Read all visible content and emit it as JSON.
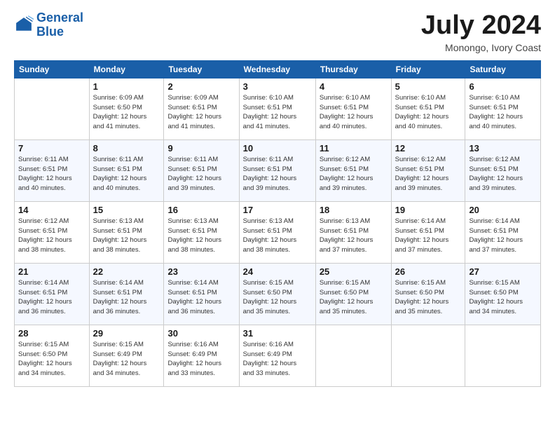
{
  "header": {
    "logo_line1": "General",
    "logo_line2": "Blue",
    "month_title": "July 2024",
    "location": "Monongo, Ivory Coast"
  },
  "days_of_week": [
    "Sunday",
    "Monday",
    "Tuesday",
    "Wednesday",
    "Thursday",
    "Friday",
    "Saturday"
  ],
  "weeks": [
    [
      {
        "day": "",
        "info": ""
      },
      {
        "day": "1",
        "info": "Sunrise: 6:09 AM\nSunset: 6:50 PM\nDaylight: 12 hours\nand 41 minutes."
      },
      {
        "day": "2",
        "info": "Sunrise: 6:09 AM\nSunset: 6:51 PM\nDaylight: 12 hours\nand 41 minutes."
      },
      {
        "day": "3",
        "info": "Sunrise: 6:10 AM\nSunset: 6:51 PM\nDaylight: 12 hours\nand 41 minutes."
      },
      {
        "day": "4",
        "info": "Sunrise: 6:10 AM\nSunset: 6:51 PM\nDaylight: 12 hours\nand 40 minutes."
      },
      {
        "day": "5",
        "info": "Sunrise: 6:10 AM\nSunset: 6:51 PM\nDaylight: 12 hours\nand 40 minutes."
      },
      {
        "day": "6",
        "info": "Sunrise: 6:10 AM\nSunset: 6:51 PM\nDaylight: 12 hours\nand 40 minutes."
      }
    ],
    [
      {
        "day": "7",
        "info": "Sunrise: 6:11 AM\nSunset: 6:51 PM\nDaylight: 12 hours\nand 40 minutes."
      },
      {
        "day": "8",
        "info": "Sunrise: 6:11 AM\nSunset: 6:51 PM\nDaylight: 12 hours\nand 40 minutes."
      },
      {
        "day": "9",
        "info": "Sunrise: 6:11 AM\nSunset: 6:51 PM\nDaylight: 12 hours\nand 39 minutes."
      },
      {
        "day": "10",
        "info": "Sunrise: 6:11 AM\nSunset: 6:51 PM\nDaylight: 12 hours\nand 39 minutes."
      },
      {
        "day": "11",
        "info": "Sunrise: 6:12 AM\nSunset: 6:51 PM\nDaylight: 12 hours\nand 39 minutes."
      },
      {
        "day": "12",
        "info": "Sunrise: 6:12 AM\nSunset: 6:51 PM\nDaylight: 12 hours\nand 39 minutes."
      },
      {
        "day": "13",
        "info": "Sunrise: 6:12 AM\nSunset: 6:51 PM\nDaylight: 12 hours\nand 39 minutes."
      }
    ],
    [
      {
        "day": "14",
        "info": "Sunrise: 6:12 AM\nSunset: 6:51 PM\nDaylight: 12 hours\nand 38 minutes."
      },
      {
        "day": "15",
        "info": "Sunrise: 6:13 AM\nSunset: 6:51 PM\nDaylight: 12 hours\nand 38 minutes."
      },
      {
        "day": "16",
        "info": "Sunrise: 6:13 AM\nSunset: 6:51 PM\nDaylight: 12 hours\nand 38 minutes."
      },
      {
        "day": "17",
        "info": "Sunrise: 6:13 AM\nSunset: 6:51 PM\nDaylight: 12 hours\nand 38 minutes."
      },
      {
        "day": "18",
        "info": "Sunrise: 6:13 AM\nSunset: 6:51 PM\nDaylight: 12 hours\nand 37 minutes."
      },
      {
        "day": "19",
        "info": "Sunrise: 6:14 AM\nSunset: 6:51 PM\nDaylight: 12 hours\nand 37 minutes."
      },
      {
        "day": "20",
        "info": "Sunrise: 6:14 AM\nSunset: 6:51 PM\nDaylight: 12 hours\nand 37 minutes."
      }
    ],
    [
      {
        "day": "21",
        "info": "Sunrise: 6:14 AM\nSunset: 6:51 PM\nDaylight: 12 hours\nand 36 minutes."
      },
      {
        "day": "22",
        "info": "Sunrise: 6:14 AM\nSunset: 6:51 PM\nDaylight: 12 hours\nand 36 minutes."
      },
      {
        "day": "23",
        "info": "Sunrise: 6:14 AM\nSunset: 6:51 PM\nDaylight: 12 hours\nand 36 minutes."
      },
      {
        "day": "24",
        "info": "Sunrise: 6:15 AM\nSunset: 6:50 PM\nDaylight: 12 hours\nand 35 minutes."
      },
      {
        "day": "25",
        "info": "Sunrise: 6:15 AM\nSunset: 6:50 PM\nDaylight: 12 hours\nand 35 minutes."
      },
      {
        "day": "26",
        "info": "Sunrise: 6:15 AM\nSunset: 6:50 PM\nDaylight: 12 hours\nand 35 minutes."
      },
      {
        "day": "27",
        "info": "Sunrise: 6:15 AM\nSunset: 6:50 PM\nDaylight: 12 hours\nand 34 minutes."
      }
    ],
    [
      {
        "day": "28",
        "info": "Sunrise: 6:15 AM\nSunset: 6:50 PM\nDaylight: 12 hours\nand 34 minutes."
      },
      {
        "day": "29",
        "info": "Sunrise: 6:15 AM\nSunset: 6:49 PM\nDaylight: 12 hours\nand 34 minutes."
      },
      {
        "day": "30",
        "info": "Sunrise: 6:16 AM\nSunset: 6:49 PM\nDaylight: 12 hours\nand 33 minutes."
      },
      {
        "day": "31",
        "info": "Sunrise: 6:16 AM\nSunset: 6:49 PM\nDaylight: 12 hours\nand 33 minutes."
      },
      {
        "day": "",
        "info": ""
      },
      {
        "day": "",
        "info": ""
      },
      {
        "day": "",
        "info": ""
      }
    ]
  ]
}
